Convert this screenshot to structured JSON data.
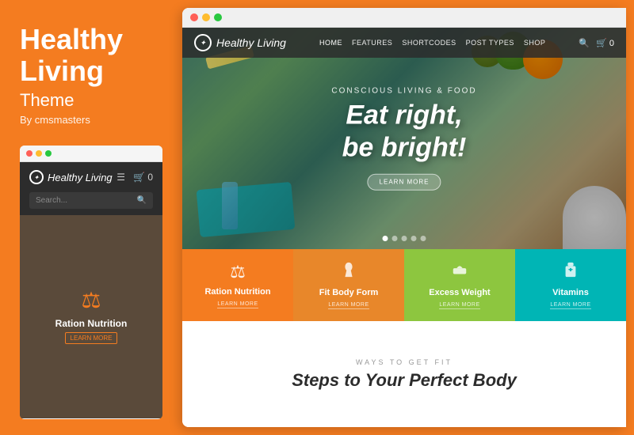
{
  "left": {
    "title": "Healthy Living",
    "subtitle": "Theme",
    "by": "By cmsmasters",
    "mini_browser": {
      "logo": "Healthy Living",
      "search_placeholder": "Search...",
      "category": {
        "label": "Ration Nutrition",
        "learn_more": "LEARN MORE"
      }
    }
  },
  "browser": {
    "titlebar_dots": [
      "red",
      "yellow",
      "green"
    ],
    "site": {
      "logo": "Healthy Living",
      "nav_items": [
        "HOME",
        "FEATURES",
        "SHORTCODES",
        "POST TYPES",
        "SHOP"
      ],
      "hero": {
        "tagline": "Conscious Living & Food",
        "title_line1": "Eat right,",
        "title_line2": "be bright!",
        "btn_label": "LEARN MORE",
        "dots": [
          true,
          false,
          false,
          false,
          false
        ]
      },
      "tiles": [
        {
          "label": "Ration Nutrition",
          "learn_more": "LEARN MORE",
          "color": "orange",
          "icon": "⚖"
        },
        {
          "label": "Fit Body Form",
          "learn_more": "LEARN MORE",
          "color": "light-orange",
          "icon": "👗"
        },
        {
          "label": "Excess Weight",
          "learn_more": "LEARN MORE",
          "color": "green",
          "icon": "⚖"
        },
        {
          "label": "Vitamins",
          "learn_more": "LEARN MORE",
          "color": "teal",
          "icon": "💊"
        }
      ],
      "bottom": {
        "ways_label": "WAYS TO GET FIT",
        "title": "Steps to Your Perfect Body"
      }
    }
  }
}
